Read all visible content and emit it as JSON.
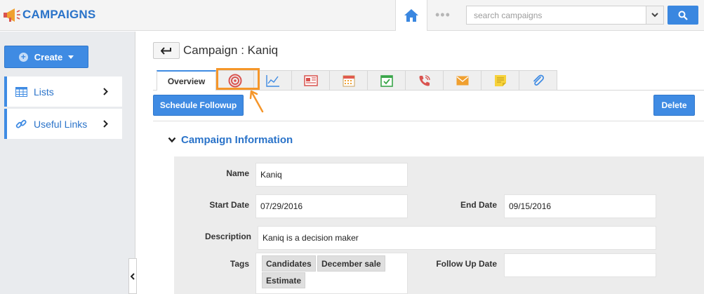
{
  "app": {
    "title": "CAMPAIGNS"
  },
  "search": {
    "placeholder": "search campaigns"
  },
  "topbar": {
    "dots": "•••"
  },
  "sidebar": {
    "create_label": "Create",
    "items": [
      {
        "label": "Lists",
        "icon": "table-icon"
      },
      {
        "label": "Useful Links",
        "icon": "link-icon"
      }
    ]
  },
  "header": {
    "title": "Campaign : Kaniq"
  },
  "tabs": [
    {
      "label": "Overview",
      "active": true
    },
    {
      "icon": "target-icon",
      "highlighted": true
    },
    {
      "icon": "line-chart-icon"
    },
    {
      "icon": "newspaper-icon"
    },
    {
      "icon": "calendar-icon"
    },
    {
      "icon": "task-check-icon"
    },
    {
      "icon": "phone-icon"
    },
    {
      "icon": "mail-icon"
    },
    {
      "icon": "note-icon"
    },
    {
      "icon": "paperclip-icon"
    }
  ],
  "actions": {
    "schedule_followup": "Schedule Followup",
    "delete": "Delete"
  },
  "section": {
    "title": "Campaign Information"
  },
  "fields": {
    "name_label": "Name",
    "name_value": "Kaniq",
    "start_date_label": "Start Date",
    "start_date_value": "07/29/2016",
    "end_date_label": "End Date",
    "end_date_value": "09/15/2016",
    "description_label": "Description",
    "description_value": "Kaniq is a decision maker",
    "tags_label": "Tags",
    "tags": [
      "Candidates",
      "December sale",
      "Estimate"
    ],
    "follow_up_label": "Follow Up Date",
    "follow_up_value": ""
  },
  "colors": {
    "accent": "#3f8be3",
    "brand": "#2a73c9",
    "highlight": "#f5962a"
  }
}
